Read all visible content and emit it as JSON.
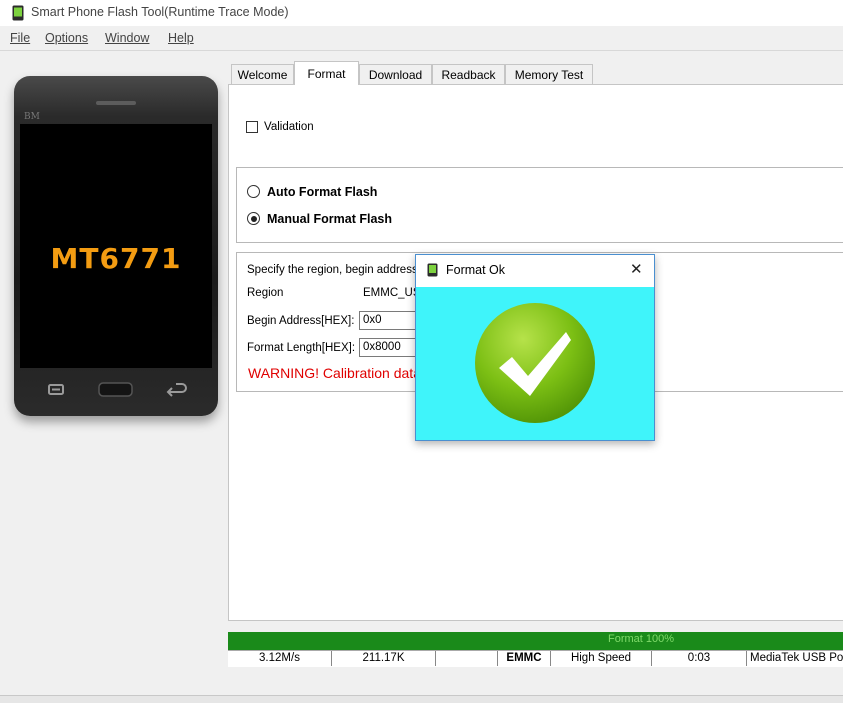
{
  "window": {
    "title": "Smart Phone Flash Tool(Runtime Trace Mode)"
  },
  "menu": {
    "items": [
      {
        "label": "File"
      },
      {
        "label": "Options"
      },
      {
        "label": "Window"
      },
      {
        "label": "Help"
      }
    ]
  },
  "phone": {
    "brand": "BM",
    "model": "MT6771"
  },
  "tabs": [
    {
      "label": "Welcome",
      "active": false
    },
    {
      "label": "Format",
      "active": true
    },
    {
      "label": "Download",
      "active": false
    },
    {
      "label": "Readback",
      "active": false
    },
    {
      "label": "Memory Test",
      "active": false
    }
  ],
  "format": {
    "validation_label": "Validation",
    "validation_checked": false,
    "auto_label": "Auto Format Flash",
    "manual_label": "Manual Format Flash",
    "selected_mode": "manual",
    "instruction": "Specify the region, begin address",
    "region_label": "Region",
    "region_value": "EMMC_USE",
    "begin_label": "Begin Address[HEX]:",
    "begin_value": "0x0",
    "length_label": "Format Length[HEX]:",
    "length_value": "0x8000",
    "warning": "WARNING! Calibration data i"
  },
  "dialog": {
    "title": "Format Ok",
    "close": "✕"
  },
  "progress": {
    "label": "Format 100%",
    "percent": 100,
    "color": "#1a8a1a"
  },
  "status": {
    "speed": "3.12M/s",
    "size": "211.17K",
    "empty": "",
    "storage": "EMMC",
    "usb_speed": "High Speed",
    "time": "0:03",
    "port": "MediaTek USB Port"
  },
  "colors": {
    "warning": "#e00000",
    "dialog_bg": "#3ff4fa",
    "phone_model": "#f39c12"
  }
}
